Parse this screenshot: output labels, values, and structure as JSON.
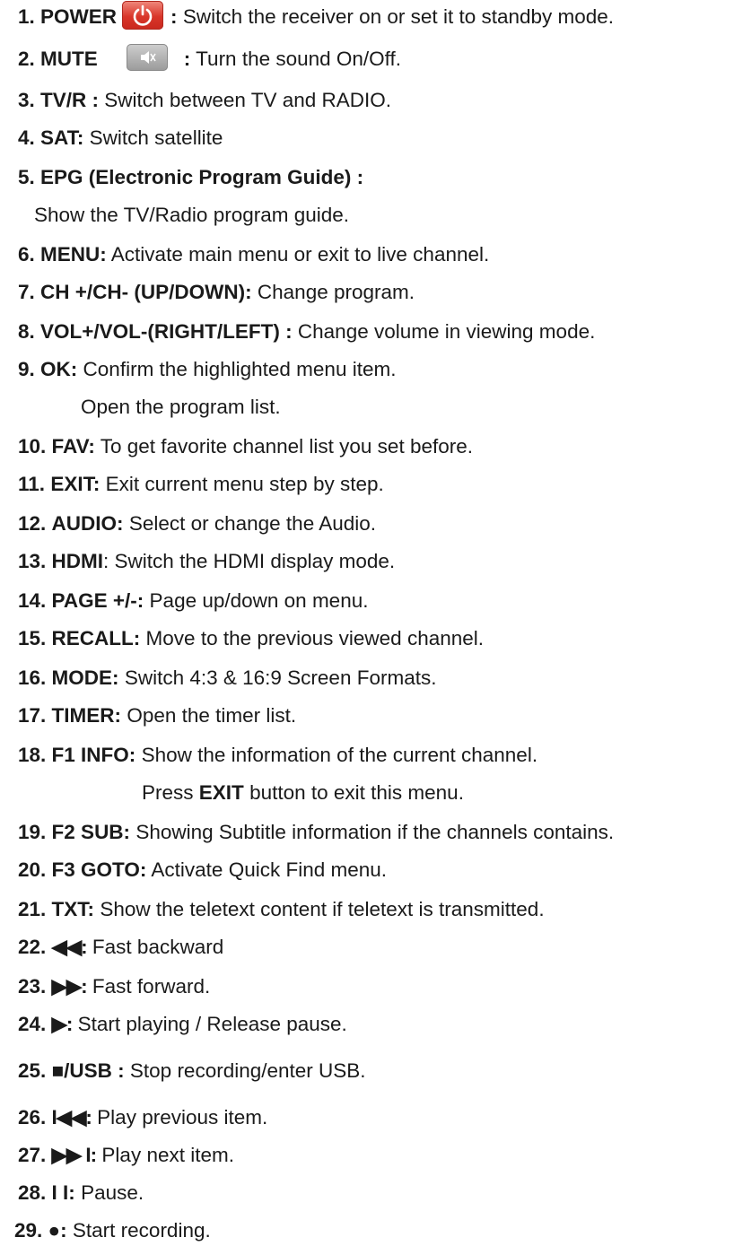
{
  "items": [
    {
      "num": "1.",
      "label": "POWER",
      "sep": ":",
      "text": "Switch the receiver on or set it to standby mode.",
      "icon": "power-icon"
    },
    {
      "num": "2.",
      "label": "MUTE",
      "sep": ":",
      "text": "Turn the sound On/Off.",
      "icon": "speaker-mute-icon"
    },
    {
      "num": "3.",
      "label": "TV/R :",
      "text": "Switch between TV and RADIO."
    },
    {
      "num": "4.",
      "label": "SAT:",
      "text": "Switch satellite"
    },
    {
      "num": "5.",
      "label": "EPG (Electronic Program Guide) :",
      "text": ""
    },
    {
      "cont": "Show the TV/Radio program guide."
    },
    {
      "num": "6.",
      "label": "MENU:",
      "text": "Activate main menu or exit to live channel."
    },
    {
      "num": "7.",
      "label": "CH +/CH- (UP/DOWN):",
      "text": "Change program."
    },
    {
      "num": "8.",
      "label": "VOL+/VOL-(RIGHT/LEFT) :",
      "text": "Change volume in viewing mode."
    },
    {
      "num": "9.",
      "label": "OK:",
      "text": "Confirm the highlighted menu item."
    },
    {
      "cont": "Open the program list."
    },
    {
      "num": "10.",
      "label": "FAV:",
      "text": "To get favorite channel list you set before."
    },
    {
      "num": "11.",
      "label": "EXIT:",
      "text": "Exit current menu step by step."
    },
    {
      "num": "12.",
      "label": "AUDIO:",
      "text": "Select or change the Audio."
    },
    {
      "num": "13.",
      "label": "HDMI",
      "text": ": Switch the HDMI display mode."
    },
    {
      "num": "14.",
      "label": "PAGE +/-:",
      "text": "Page up/down on menu."
    },
    {
      "num": "15.",
      "label": "RECALL:",
      "text": "Move to the previous viewed channel."
    },
    {
      "num": "16.",
      "label": "MODE:",
      "text": "Switch 4:3 & 16:9 Screen Formats."
    },
    {
      "num": "17.",
      "label": "TIMER:",
      "text": "Open the timer list."
    },
    {
      "num": "18.",
      "label": "F1 INFO:",
      "text": "Show the information of the current channel."
    },
    {
      "cont_pre": "Press",
      "cont_bold": "EXIT",
      "cont_post": "button to exit this menu."
    },
    {
      "num": "19.",
      "label": "F2 SUB:",
      "text": "Showing Subtitle information if the channels contains."
    },
    {
      "num": "20.",
      "label": "F3 GOTO:",
      "text": "Activate Quick Find menu."
    },
    {
      "num": "21.",
      "label": "TXT:",
      "text": "Show the teletext content if teletext is transmitted."
    },
    {
      "num": "22.",
      "label": "◀◀:",
      "text": "Fast backward"
    },
    {
      "num": "23.",
      "label": "▶▶:",
      "text": "Fast forward."
    },
    {
      "num": "24.",
      "label": "▶:",
      "text": "Start playing / Release pause."
    },
    {
      "num": "25.",
      "label": "■/USB :",
      "text": "Stop recording/enter USB."
    },
    {
      "num": "26.",
      "label": "I◀◀:",
      "text": "Play previous item."
    },
    {
      "num": "27.",
      "label": "▶▶ I:",
      "text": "Play next item."
    },
    {
      "num": "28.",
      "label": "I I:",
      "text": "Pause."
    },
    {
      "num": "29.",
      "label": "●:",
      "text": "Start recording."
    }
  ]
}
